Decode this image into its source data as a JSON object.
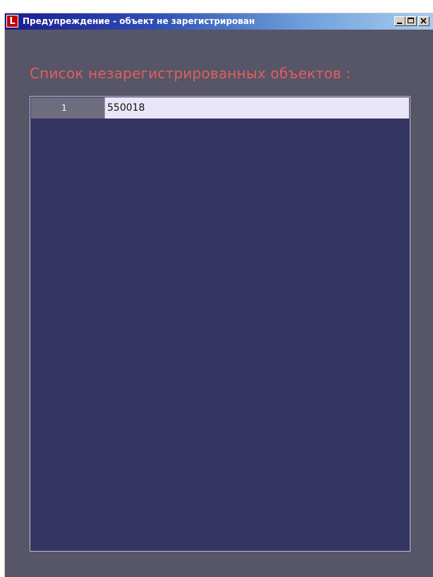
{
  "window": {
    "title": "Предупреждение - объект не зарегистрирован",
    "icon_letter": "L",
    "icon": "app-logo-icon"
  },
  "content": {
    "heading": "Список незарегистрированных объектов :",
    "rows": [
      {
        "index": "1",
        "value": "550018"
      }
    ]
  },
  "colors": {
    "window_bg": "#575568",
    "grid_bg": "#353562",
    "heading": "#e0605a",
    "row_value_bg": "#e8e6f8",
    "row_index_bg": "#6e6c7f"
  }
}
